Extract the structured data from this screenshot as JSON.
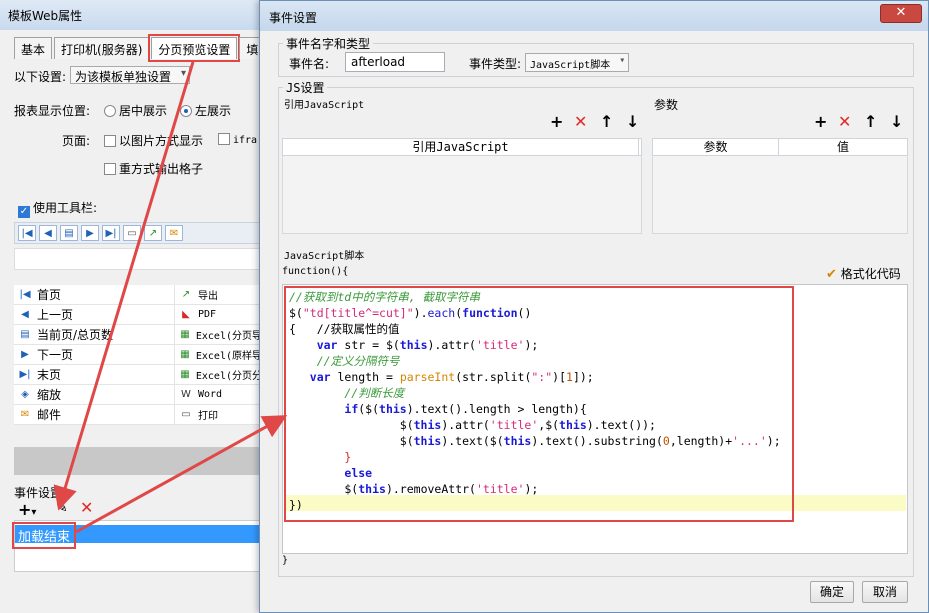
{
  "left_window": {
    "title": "模板Web属性",
    "tabs": [
      "基本",
      "打印机(服务器)",
      "分页预览设置",
      "填"
    ],
    "setting_label": "以下设置:",
    "setting_value": "为该模板单独设置",
    "position_label": "报表显示位置:",
    "pos_center": "居中展示",
    "pos_left": "左展示",
    "page_label": "页面:",
    "img_mode": "以图片方式显示",
    "iframe": "ifra",
    "repeat_grid": "重方式输出格子",
    "use_toolbar": "使用工具栏:",
    "toolbar_items": [
      {
        "left": "首页",
        "left_icon": "first-page-icon",
        "right": "导出",
        "right_icon": "export-icon"
      },
      {
        "left": "上一页",
        "left_icon": "prev-page-icon",
        "right": "PDF",
        "right_icon": "pdf-icon"
      },
      {
        "left": "当前页/总页数",
        "left_icon": "page-count-icon",
        "right": "Excel(分页导",
        "right_icon": "excel-icon"
      },
      {
        "left": "下一页",
        "left_icon": "next-page-icon",
        "right": "Excel(原样导",
        "right_icon": "excel-icon"
      },
      {
        "left": "末页",
        "left_icon": "last-page-icon",
        "right": "Excel(分页分",
        "right_icon": "excel-icon"
      },
      {
        "left": "缩放",
        "left_icon": "zoom-icon",
        "right": "Word",
        "right_icon": "word-icon"
      },
      {
        "left": "邮件",
        "left_icon": "mail-icon",
        "right": "打印",
        "right_icon": "print-icon"
      }
    ],
    "event_settings": "事件设置:",
    "event_item": "加载结束"
  },
  "dialog": {
    "title": "事件设置",
    "close": "✕",
    "group_name_type": "事件名字和类型",
    "event_name_label": "事件名:",
    "event_name_value": "afterload",
    "event_type_label": "事件类型:",
    "event_type_value": "JavaScript脚本",
    "group_js": "JS设置",
    "ref_js": "引用JavaScript",
    "params": "参数",
    "ref_js_col": "引用JavaScript",
    "param_col": "参数",
    "value_col": "值",
    "js_script": "JavaScript脚本",
    "fn_open": "function(){",
    "format_code": "格式化代码",
    "fn_close": "}",
    "ok": "确定",
    "cancel": "取消",
    "code_lines": [
      "//获取到td中的字符串, 截取字符串",
      "$(\"td[title^=cut]\").each(function()",
      "{   //获取属性的值",
      "    var str = $(this).attr('title');",
      "    //定义分隔符号",
      "   var length = parseInt(str.split(\":\")[1]);",
      "        //判断长度",
      "        if($(this).text().length > length){",
      "                $(this).attr('title',$(this).text());",
      "                $(this).text($(this).text().substring(0,length)+'...');",
      "        }",
      "        else",
      "        $(this).removeAttr('title');",
      "})"
    ]
  }
}
